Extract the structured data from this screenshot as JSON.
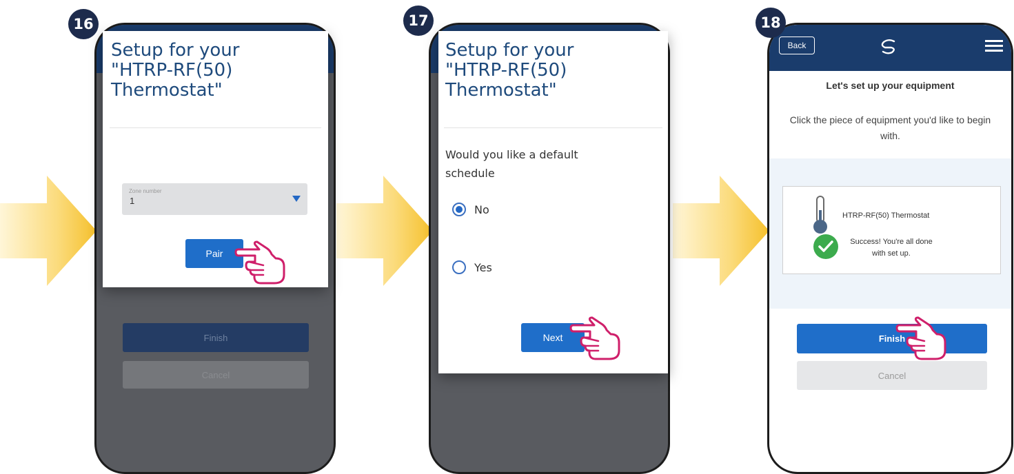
{
  "steps": [
    {
      "number": "16",
      "modal": {
        "title": "Setup for your\n\"HTRP-RF(50)\nThermostat\"",
        "zone_label": "Zone number",
        "zone_value": "1",
        "pair_label": "Pair"
      },
      "background": {
        "finish_label": "Finish",
        "cancel_label": "Cancel"
      }
    },
    {
      "number": "17",
      "modal": {
        "title": "Setup for your\n\"HTRP-RF(50)\nThermostat\"",
        "question": "Would you like a default schedule",
        "options": [
          {
            "label": "No",
            "selected": true
          },
          {
            "label": "Yes",
            "selected": false
          }
        ],
        "next_label": "Next"
      }
    },
    {
      "number": "18",
      "header": {
        "back_label": "Back"
      },
      "heading": "Let's set up your equipment",
      "instruction": "Click the piece of equipment you'd like to begin with.",
      "device": {
        "name": "HTRP-RF(50) Thermostat",
        "status": "Success! You're all done with set up."
      },
      "finish_label": "Finish",
      "cancel_label": "Cancel"
    }
  ],
  "colors": {
    "header_blue": "#1a3c6c",
    "button_blue": "#1f6ec9",
    "title_blue": "#1e4a7c",
    "success_green": "#3cab4d",
    "hand_magenta": "#cf1f6a",
    "arrow_yellow": "#f5c02c"
  }
}
